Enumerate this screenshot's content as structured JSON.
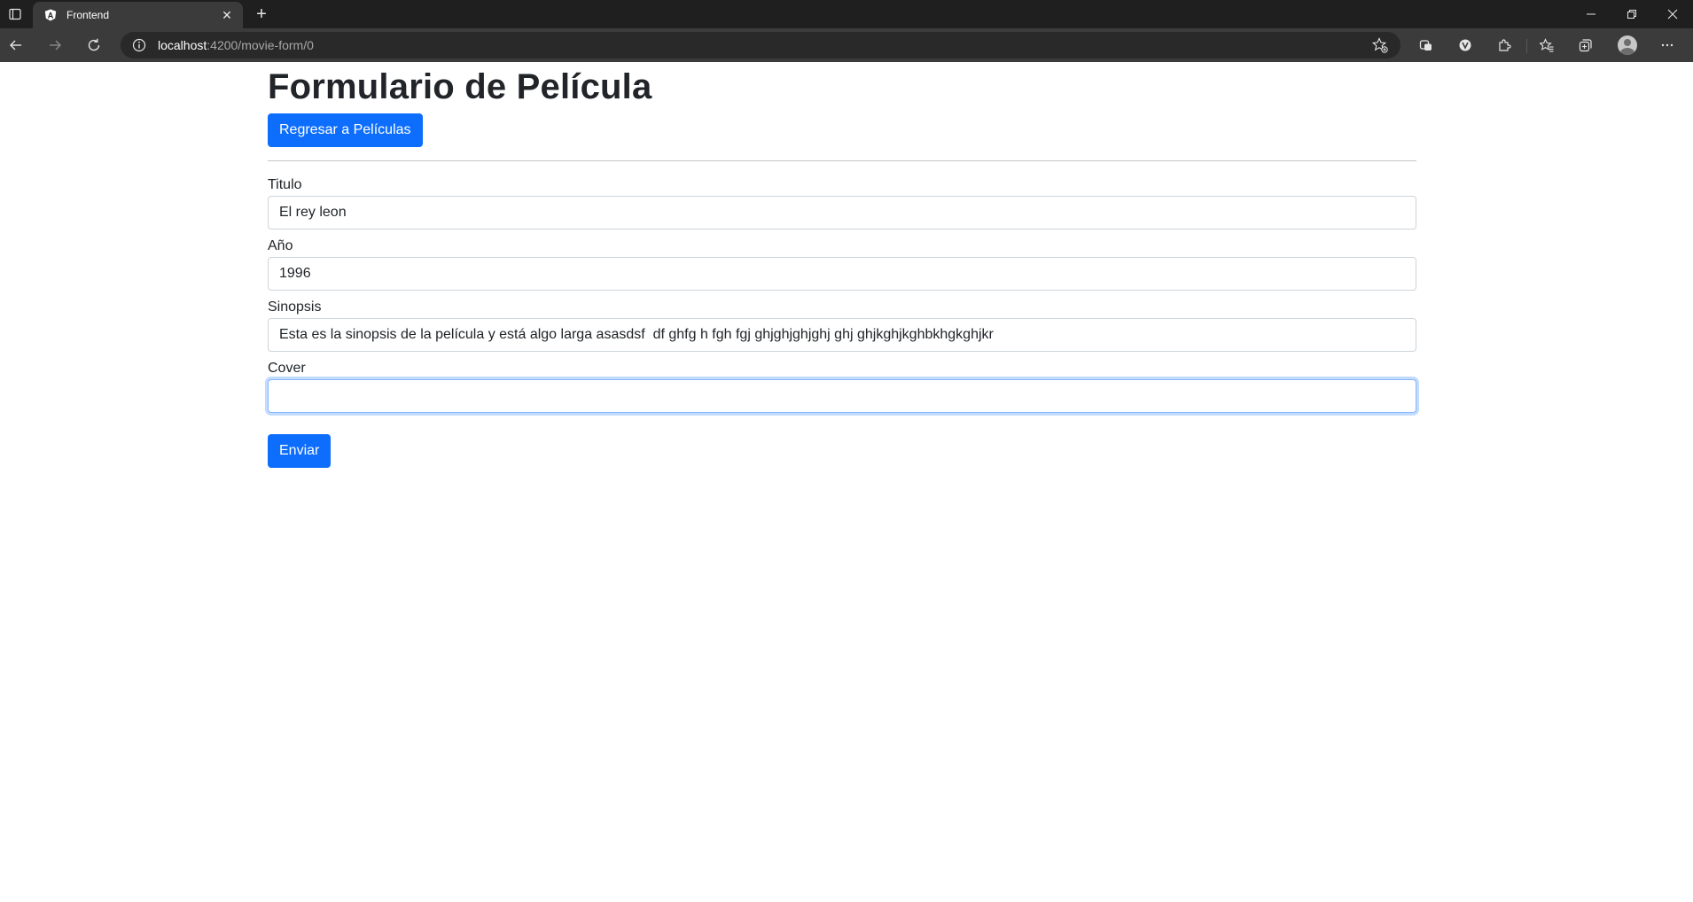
{
  "browser": {
    "tab": {
      "title": "Frontend",
      "favicon_letter": "A",
      "close_glyph": "✕"
    },
    "new_tab_glyph": "+",
    "address": {
      "host": "localhost",
      "rest": ":4200/movie-form/0"
    }
  },
  "page": {
    "title": "Formulario de Película",
    "back_button": "Regresar a Películas",
    "submit_button": "Enviar"
  },
  "form": {
    "titulo": {
      "label": "Titulo",
      "value": "El rey leon"
    },
    "anio": {
      "label": "Año",
      "value": "1996"
    },
    "sinopsis": {
      "label": "Sinopsis",
      "value": "Esta es la sinopsis de la película y está algo larga asasdsf  df ghfg h fgh fgj ghjghjghjghj ghj ghjkghjkghbkhgkghjkr"
    },
    "cover": {
      "label": "Cover",
      "value": ""
    }
  },
  "colors": {
    "primary": "#0d6efd",
    "chrome_dark": "#1f1f1f",
    "chrome_toolbar": "#3b3b3b",
    "text": "#212529"
  }
}
